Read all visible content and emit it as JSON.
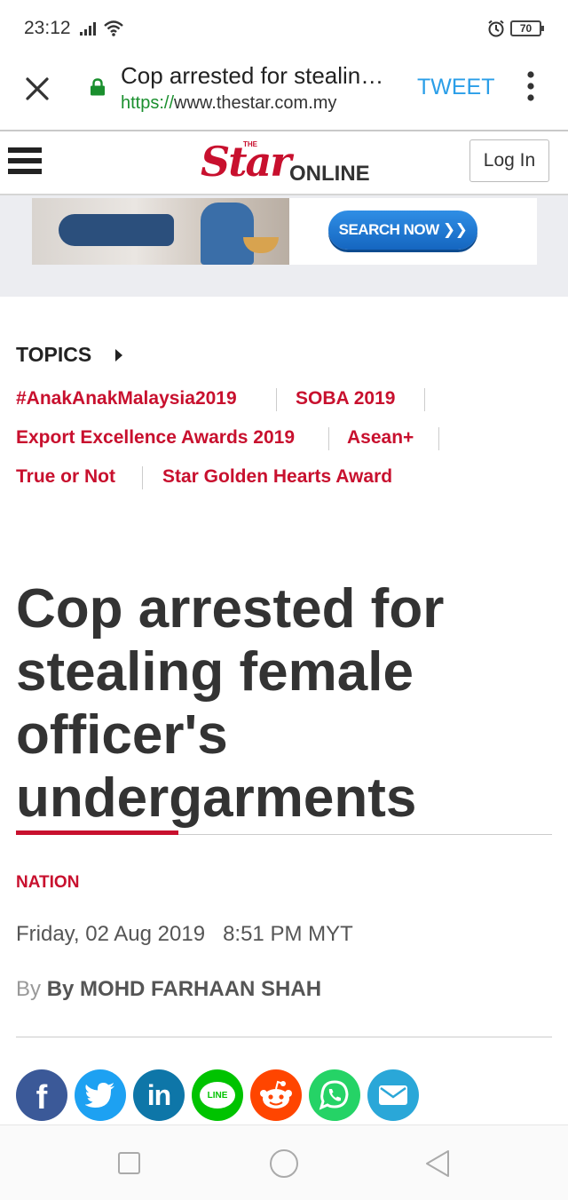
{
  "status_bar": {
    "time": "23:12",
    "battery": "70",
    "icons": [
      "signal-icon",
      "wifi-icon",
      "alarm-icon",
      "battery-icon"
    ]
  },
  "browser": {
    "page_title": "Cop arrested for stealing female officer's undergarments",
    "url_scheme": "https://",
    "url_host": "www.thestar.com.my",
    "tweet_label": "TWEET",
    "icons": [
      "close-icon",
      "lock-icon",
      "more-vert-icon"
    ]
  },
  "site_header": {
    "logo_the": "THE",
    "logo_star": "Star",
    "logo_online": "ONLINE",
    "login_label": "Log In"
  },
  "ad": {
    "button_label": "SEARCH NOW ❯❯"
  },
  "topics": {
    "title": "TOPICS",
    "items": [
      "#AnakAnakMalaysia2019",
      "SOBA 2019",
      "Export Excellence Awards 2019",
      "Asean+",
      "True or Not",
      "Star Golden Hearts Award"
    ]
  },
  "article": {
    "headline": "Cop arrested for stealing female officer's undergarments",
    "section": "NATION",
    "date": "Friday, 02 Aug 2019",
    "time": "8:51 PM MYT",
    "by_prefix": "By",
    "author": "By MOHD FARHAAN SHAH"
  },
  "share": [
    {
      "name": "facebook",
      "glyph": "f",
      "color": "#3b5998"
    },
    {
      "name": "twitter",
      "glyph": "",
      "color": "#1da1f2"
    },
    {
      "name": "linkedin",
      "glyph": "in",
      "color": "#0e76a8"
    },
    {
      "name": "line",
      "glyph": "LINE",
      "color": "#00c300"
    },
    {
      "name": "reddit",
      "glyph": "",
      "color": "#ff4500"
    },
    {
      "name": "whatsapp",
      "glyph": "",
      "color": "#25d366"
    },
    {
      "name": "email",
      "glyph": "",
      "color": "#2aa7d8"
    }
  ],
  "colors": {
    "brand_red": "#c8102e",
    "link_blue": "#2a9ee8",
    "secure_green": "#1a8f2e"
  }
}
